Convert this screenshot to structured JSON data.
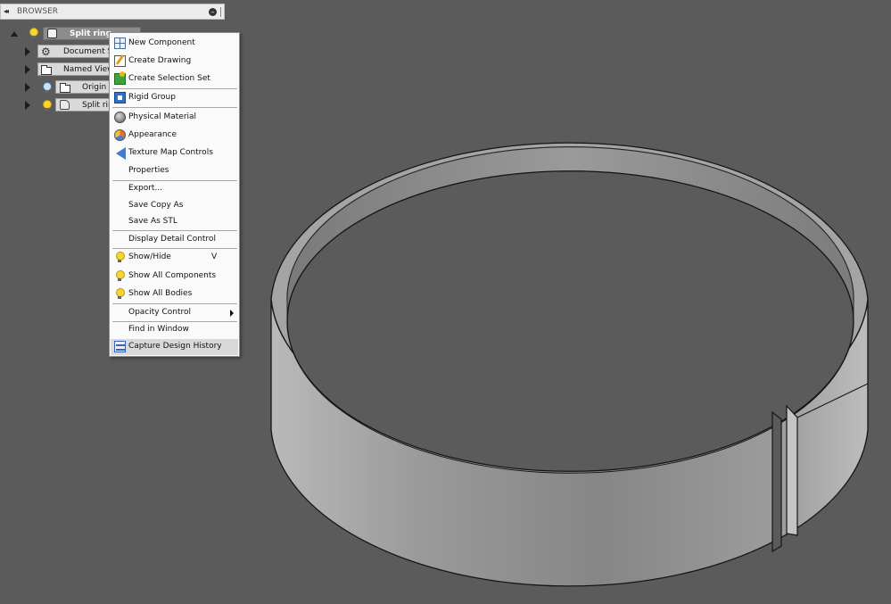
{
  "browser": {
    "collapse_glyph": "◂◂",
    "title": "BROWSER",
    "pin_glyph": "–",
    "tree": {
      "root_label": "Split ring",
      "items": [
        {
          "label": "Document Se"
        },
        {
          "label": "Named View"
        },
        {
          "label": "Origin"
        },
        {
          "label": "Split rin"
        }
      ]
    }
  },
  "context_menu": {
    "items": [
      {
        "label": "New Component",
        "icon": "new-component-icon"
      },
      {
        "label": "Create Drawing",
        "icon": "drawing-icon"
      },
      {
        "label": "Create Selection Set",
        "icon": "selection-set-icon"
      },
      {
        "label": "Rigid Group",
        "icon": "rigid-group-icon"
      },
      {
        "label": "Physical Material",
        "icon": "material-icon"
      },
      {
        "label": "Appearance",
        "icon": "appearance-icon"
      },
      {
        "label": "Texture Map Controls",
        "icon": "texture-map-icon"
      },
      {
        "label": "Properties"
      },
      {
        "label": "Export..."
      },
      {
        "label": "Save Copy As"
      },
      {
        "label": "Save As STL"
      },
      {
        "label": "Display Detail Control"
      },
      {
        "label": "Show/Hide",
        "icon": "bulb-icon",
        "shortcut": "V"
      },
      {
        "label": "Show All Components",
        "icon": "bulb-icon"
      },
      {
        "label": "Show All Bodies",
        "icon": "bulb-icon"
      },
      {
        "label": "Opacity Control",
        "submenu": true
      },
      {
        "label": "Find in Window"
      },
      {
        "label": "Capture Design History",
        "icon": "history-icon",
        "highlighted": true
      }
    ]
  },
  "colors": {
    "viewport_background": "#5b5b5b",
    "model_face": "#8c8c8c",
    "model_edge": "#111111",
    "selection_highlight": "#d9d9d9"
  }
}
